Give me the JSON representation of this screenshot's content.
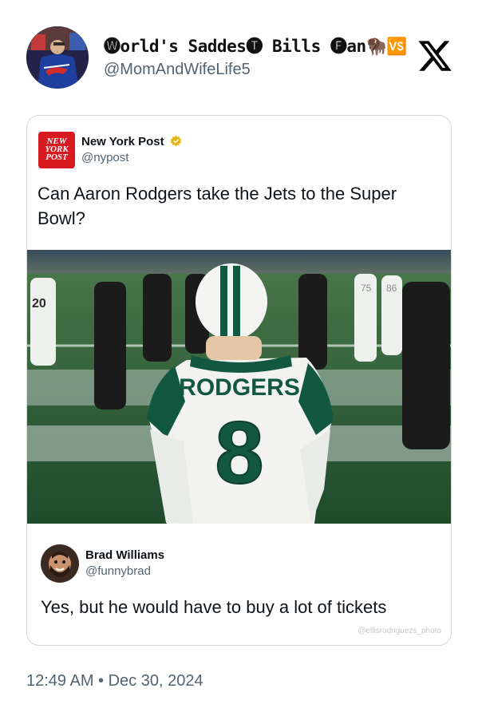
{
  "post": {
    "display_name": "🅦orld's Saddes🅣 Bills 🅕an🦬🆚",
    "handle": "@MomAndWifeLife5",
    "timestamp": "12:49 AM • Dec 30, 2024"
  },
  "quoted": {
    "logo_text": "NEW YORK POST",
    "name": "New York Post",
    "handle": "@nypost",
    "text": "Can Aaron Rodgers take the Jets to the Super Bowl?",
    "photo": {
      "jersey_name": "RODGERS",
      "jersey_number": "8",
      "background_numbers": [
        "20",
        "75",
        "86"
      ]
    }
  },
  "reply": {
    "name": "Brad Williams",
    "handle": "@funnybrad",
    "text": "Yes, but he would have to buy a lot of tickets",
    "watermark": "@ellisrodriguezs_photo"
  },
  "colors": {
    "text_primary": "#0f1419",
    "text_secondary": "#536471",
    "border": "#cfd9de",
    "nypost_red": "#d71920",
    "verified_gold": "#e2b719",
    "jets_green": "#125740",
    "field_green": "#2d6b3a"
  },
  "icons": [
    "x-logo-icon",
    "verified-badge-icon"
  ]
}
